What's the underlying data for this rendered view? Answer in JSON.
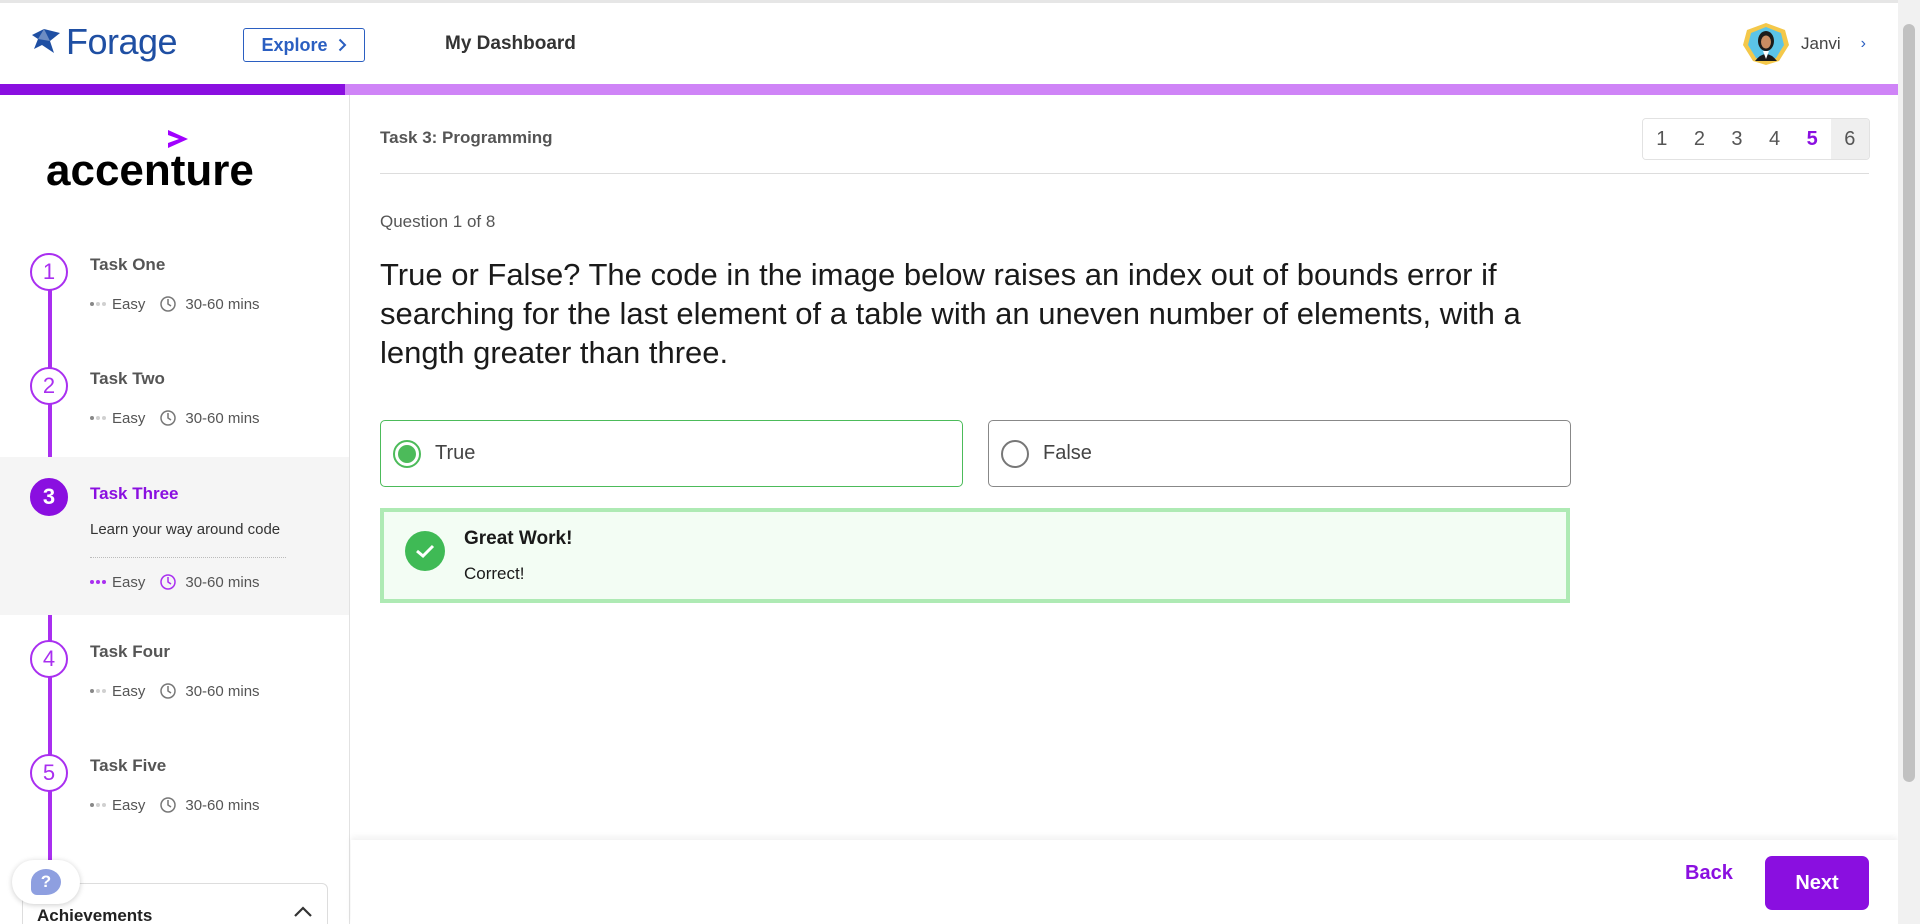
{
  "header": {
    "logo_text": "Forage",
    "explore_label": "Explore",
    "dashboard_label": "My Dashboard",
    "user_name": "Janvi"
  },
  "progress": {
    "fraction": 0.182
  },
  "sidebar": {
    "company": "accenture",
    "tasks": [
      {
        "number": "1",
        "title": "Task One",
        "difficulty": "Easy",
        "duration": "30-60 mins"
      },
      {
        "number": "2",
        "title": "Task Two",
        "difficulty": "Easy",
        "duration": "30-60 mins"
      },
      {
        "number": "3",
        "title": "Task Three",
        "description": "Learn your way around code",
        "difficulty": "Easy",
        "duration": "30-60 mins"
      },
      {
        "number": "4",
        "title": "Task Four",
        "difficulty": "Easy",
        "duration": "30-60 mins"
      },
      {
        "number": "5",
        "title": "Task Five",
        "difficulty": "Easy",
        "duration": "30-60 mins"
      }
    ],
    "help_label": "?",
    "achievements_label": "Achievements"
  },
  "main": {
    "task_heading": "Task 3: Programming",
    "pages": [
      "1",
      "2",
      "3",
      "4",
      "5",
      "6"
    ],
    "question_count": "Question 1 of 8",
    "question": "True or False? The code in the image below raises an index out of bounds error if searching for the last element of a table with an uneven number of elements, with a length greater than three.",
    "options": {
      "true_label": "True",
      "false_label": "False"
    },
    "feedback": {
      "title": "Great Work!",
      "text": "Correct!"
    }
  },
  "footer": {
    "back_label": "Back",
    "next_label": "Next"
  },
  "colors": {
    "brand_purple": "#8a0fe0",
    "progress_light": "#cf84f7",
    "success_green": "#3fba55",
    "forage_blue": "#1f4fa3"
  }
}
